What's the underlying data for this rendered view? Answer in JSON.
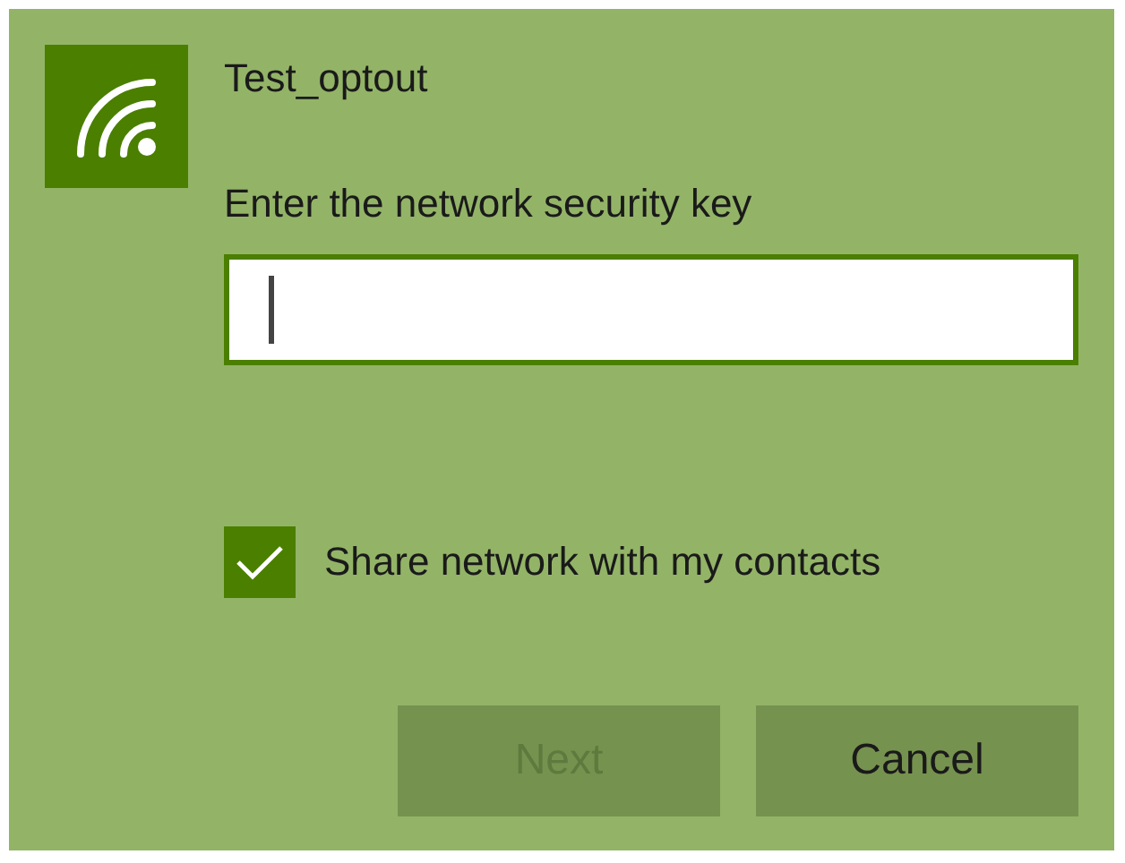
{
  "network": {
    "name": "Test_optout"
  },
  "prompt": "Enter the network security key",
  "key_field": {
    "focused": true
  },
  "share_checkbox": {
    "label": "Share network with my contacts",
    "checked": true
  },
  "buttons": [
    {
      "label": "Next",
      "disabled": true
    },
    {
      "label": "Cancel",
      "disabled": false
    }
  ]
}
